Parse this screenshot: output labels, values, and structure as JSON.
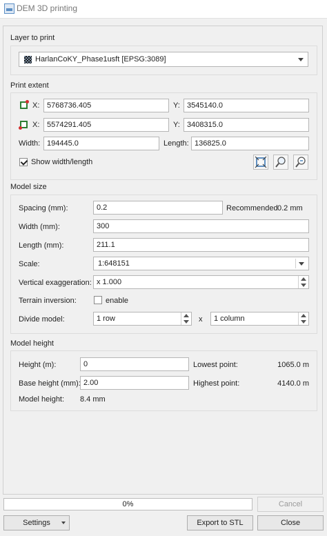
{
  "window": {
    "title": "DEM 3D printing"
  },
  "layer": {
    "section_label": "Layer to print",
    "selected": "HarlanCoKY_Phase1usft [EPSG:3089]"
  },
  "extent": {
    "section_label": "Print extent",
    "x_label": "X:",
    "y_label": "Y:",
    "x1": "5768736.405",
    "y1": "3545140.0",
    "x2": "5574291.405",
    "y2": "3408315.0",
    "width_label": "Width:",
    "width_value": "194445.0",
    "length_label": "Length:",
    "length_value": "136825.0",
    "show_wl_label": "Show width/length",
    "show_wl_checked": true,
    "tools": [
      "extent-from-canvas-icon",
      "select-extent-icon",
      "zoom-extent-icon"
    ]
  },
  "model_size": {
    "section_label": "Model size",
    "spacing_label": "Spacing (mm):",
    "spacing_value": "0.2",
    "recommended_label": "Recommended",
    "recommended_value": "0.2 mm",
    "width_label": "Width (mm):",
    "width_value": "300",
    "length_label": "Length (mm):",
    "length_value": "211.1",
    "scale_label": "Scale:",
    "scale_value": "1:648151",
    "vexag_label": "Vertical exaggeration:",
    "vexag_value": "x 1.000",
    "terrain_label": "Terrain inversion:",
    "terrain_checkbox_label": "enable",
    "terrain_checked": false,
    "divide_label": "Divide model:",
    "divide_rows": "1 row",
    "divide_x": "x",
    "divide_cols": "1 column"
  },
  "model_height": {
    "section_label": "Model height",
    "height_label": "Height (m):",
    "height_value": "0",
    "lowest_label": "Lowest point:",
    "lowest_value": "1065.0 m",
    "base_label": "Base height (mm):",
    "base_value": "2.00",
    "highest_label": "Highest point:",
    "highest_value": "4140.0 m",
    "model_height_label": "Model height:",
    "model_height_value": "8.4 mm"
  },
  "progress": {
    "text": "0%",
    "fraction": 0
  },
  "buttons": {
    "cancel": "Cancel",
    "settings": "Settings",
    "export": "Export to STL",
    "close": "Close"
  }
}
